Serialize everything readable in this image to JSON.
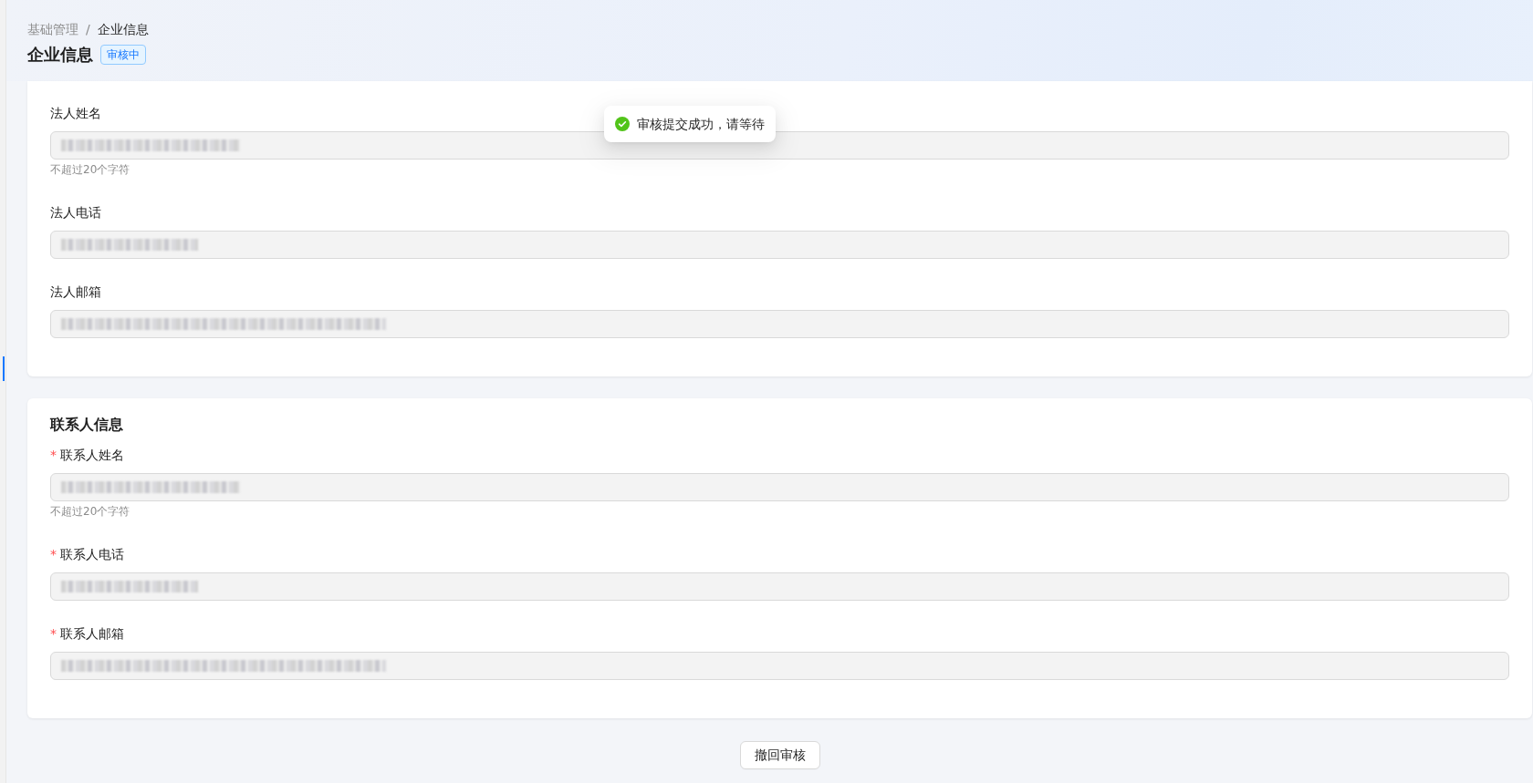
{
  "breadcrumb": {
    "separator": "/",
    "items": [
      {
        "label": "基础管理",
        "current": false
      },
      {
        "label": "企业信息",
        "current": true
      }
    ]
  },
  "page": {
    "title": "企业信息",
    "status": "审核中"
  },
  "toast": {
    "kind": "success",
    "message": "审核提交成功，请等待"
  },
  "form": {
    "required_mark": "*",
    "sections": [
      {
        "fields": [
          {
            "label": "法人姓名",
            "kind": "name",
            "required": false,
            "disabled": true,
            "redacted": true,
            "hint": "不超过20个字符"
          },
          {
            "label": "法人电话",
            "kind": "phone",
            "required": false,
            "disabled": true,
            "redacted": true
          },
          {
            "label": "法人邮箱",
            "kind": "email",
            "required": false,
            "disabled": true,
            "redacted": true
          }
        ]
      },
      {
        "title": "联系人信息",
        "fields": [
          {
            "label": "联系人姓名",
            "kind": "name",
            "required": true,
            "disabled": true,
            "redacted": true,
            "hint": "不超过20个字符"
          },
          {
            "label": "联系人电话",
            "kind": "phone",
            "required": true,
            "disabled": true,
            "redacted": true
          },
          {
            "label": "联系人邮箱",
            "kind": "email",
            "required": true,
            "disabled": true,
            "redacted": true
          }
        ]
      }
    ]
  },
  "actions": [
    {
      "label": "撤回审核"
    }
  ]
}
